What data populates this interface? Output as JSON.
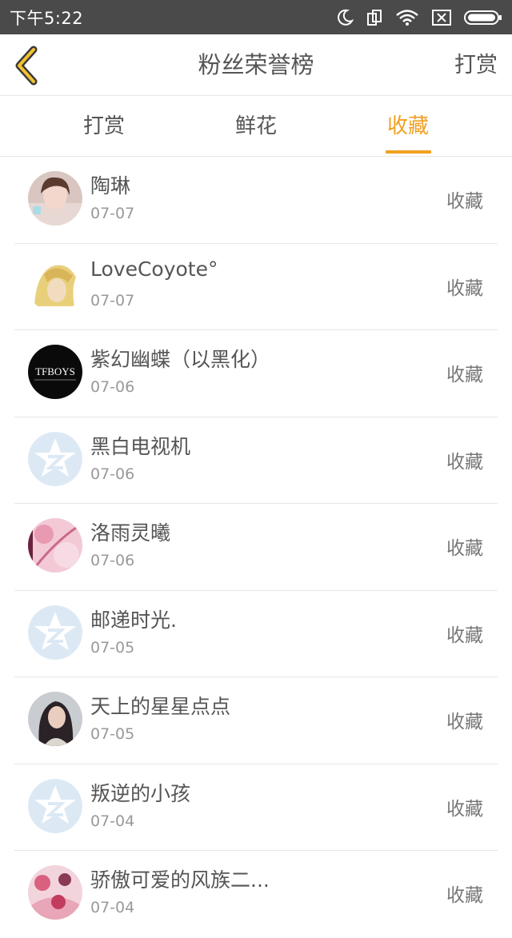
{
  "status_bar": {
    "time": "下午5:22",
    "icons": [
      "moon-icon",
      "rotate-icon",
      "wifi-icon",
      "sim-icon",
      "battery-icon"
    ]
  },
  "header": {
    "title": "粉丝荣誉榜",
    "action_label": "打赏",
    "back_icon": "chevron-left-icon"
  },
  "tabs": [
    {
      "label": "打赏",
      "active": false
    },
    {
      "label": "鲜花",
      "active": false
    },
    {
      "label": "收藏",
      "active": true
    }
  ],
  "colors": {
    "accent": "#f0a020",
    "status_bar": "#4a4a4a",
    "divider": "#e6e6e6"
  },
  "list": [
    {
      "name": "陶琳",
      "date": "07-07",
      "action": "收藏",
      "avatar": "photo-avatar"
    },
    {
      "name": "LoveCoyote°",
      "date": "07-07",
      "action": "收藏",
      "avatar": "anime-avatar"
    },
    {
      "name": "紫幻幽蝶（以黑化）",
      "date": "07-06",
      "action": "收藏",
      "avatar": "tfboys-avatar",
      "avatar_text": "TFBOYS"
    },
    {
      "name": "黑白电视机",
      "date": "07-06",
      "action": "收藏",
      "avatar": "default-avatar"
    },
    {
      "name": "洛雨灵曦",
      "date": "07-06",
      "action": "收藏",
      "avatar": "pink-art-avatar"
    },
    {
      "name": "邮递时光.",
      "date": "07-05",
      "action": "收藏",
      "avatar": "default-avatar"
    },
    {
      "name": "天上的星星点点",
      "date": "07-05",
      "action": "收藏",
      "avatar": "photo-avatar"
    },
    {
      "name": "叛逆的小孩",
      "date": "07-04",
      "action": "收藏",
      "avatar": "default-avatar"
    },
    {
      "name": "骄傲可爱的风族二...",
      "date": "07-04",
      "action": "收藏",
      "avatar": "pink-art-avatar"
    }
  ]
}
